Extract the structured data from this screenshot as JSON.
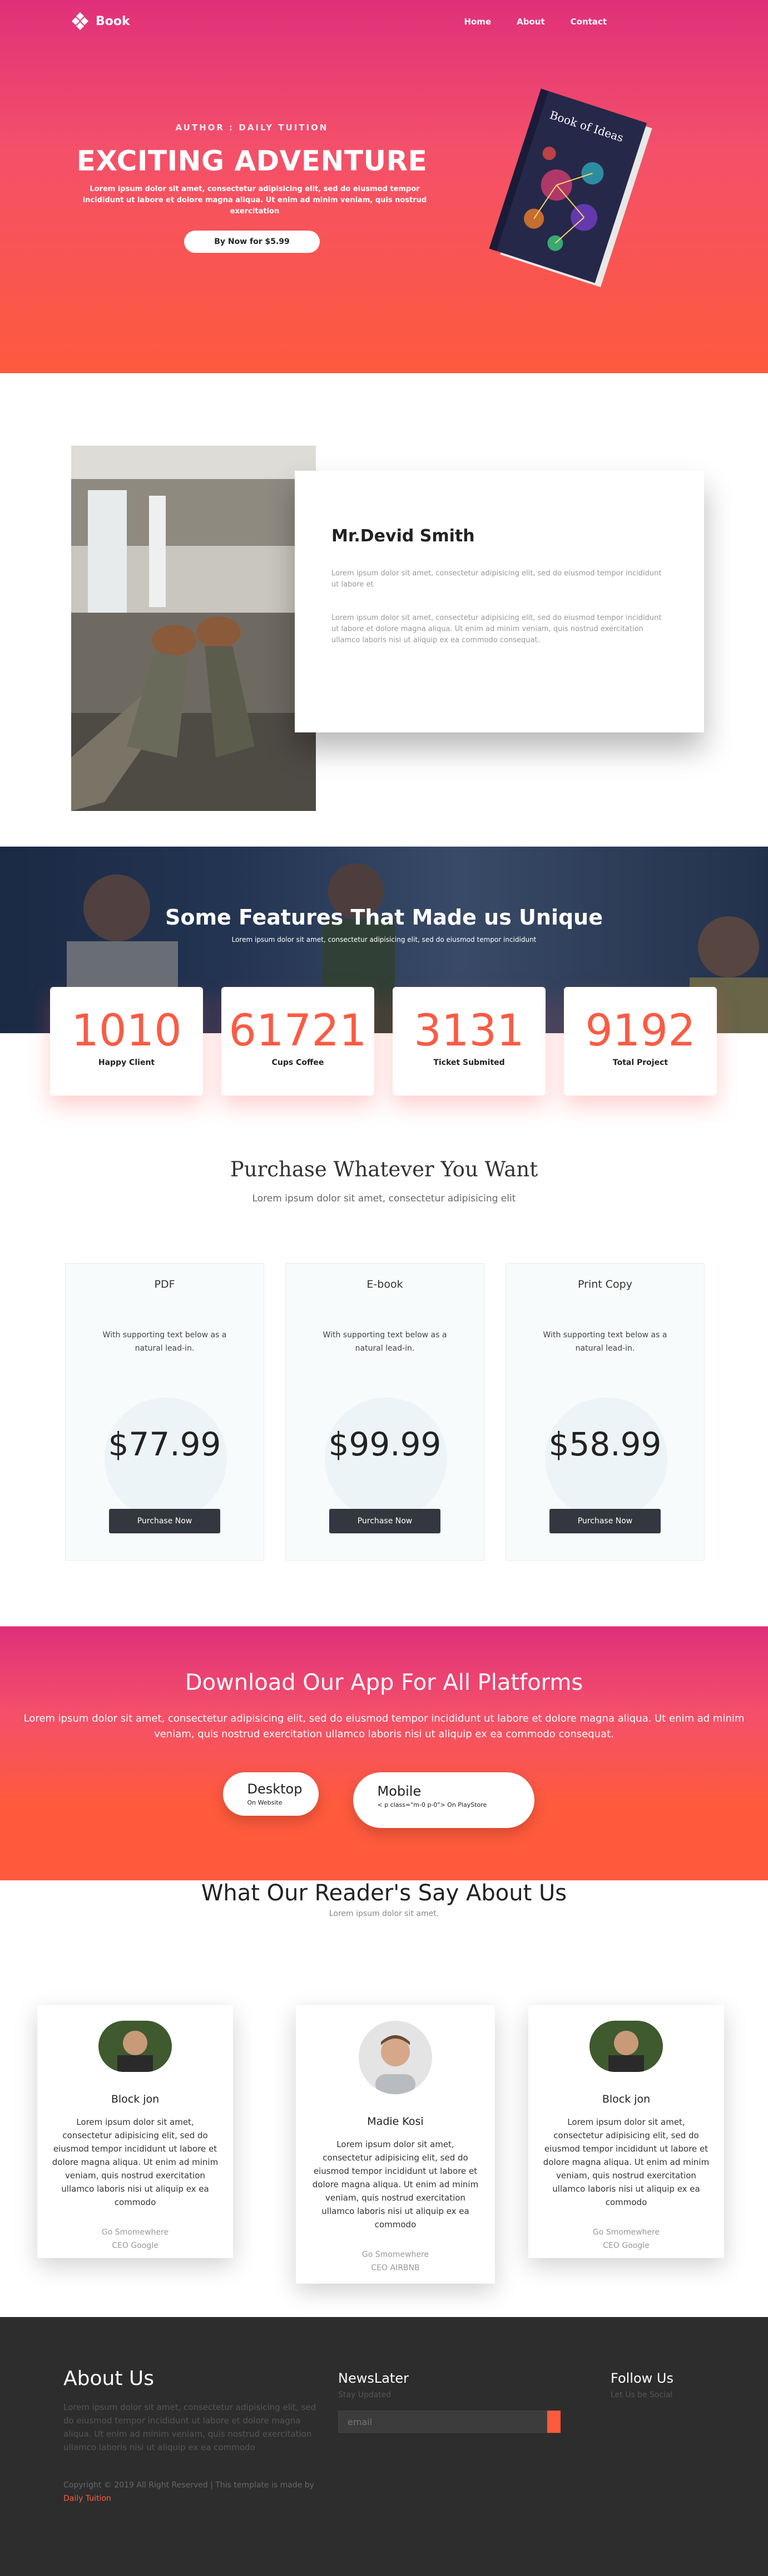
{
  "nav": {
    "brand": "Book",
    "links": [
      "Home",
      "About",
      "Contact"
    ]
  },
  "hero": {
    "subtitle": "AUTHOR : DAILY TUITION",
    "title": "EXCITING ADVENTURE",
    "description": "Lorem ipsum dolor sit amet, consectetur adipisicing elit, sed do eiusmod tempor incididunt ut labore et dolore magna aliqua. Ut enim ad minim veniam, quis nostrud exercitation",
    "button": "By Now for $5.99"
  },
  "book": {
    "cover_title": "Book of Ideas"
  },
  "profile": {
    "name": "Mr.Devid Smith",
    "p1": "Lorem ipsum dolor sit amet, consectetur adipisicing elit, sed do eiusmod tempor incididunt ut labore et",
    "p2": "Lorem ipsum dolor sit amet, consectetur adipisicing elit, sed do eiusmod tempor incididunt ut labore et dolore magna aliqua. Ut enim ad minim veniam, quis nostrud exercitation ullamco laboris nisi ut aliquip ex ea commodo consequat."
  },
  "features": {
    "title": "Some Features That Made us Unique",
    "subtitle": "Lorem ipsum dolor sit amet, consectetur adipisicing elit, sed do eiusmod tempor incididunt",
    "stats": [
      {
        "value": "1010",
        "label": "Happy Client"
      },
      {
        "value": "61721",
        "label": "Cups Coffee"
      },
      {
        "value": "3131",
        "label": "Ticket Submited"
      },
      {
        "value": "9192",
        "label": "Total Project"
      }
    ]
  },
  "purchase": {
    "title": "Purchase Whatever You Want",
    "subtitle": "Lorem ipsum dolor sit amet, consectetur adipisicing elit",
    "plans": [
      {
        "name": "PDF",
        "text": "With supporting text below as a natural lead-in.",
        "price": "$77.99",
        "button": "Purchase Now"
      },
      {
        "name": "E-book",
        "text": "With supporting text below as a natural lead-in.",
        "price": "$99.99",
        "button": "Purchase Now"
      },
      {
        "name": "Print Copy",
        "text": "With supporting text below as a natural lead-in.",
        "price": "$58.99",
        "button": "Purchase Now"
      }
    ]
  },
  "app": {
    "title": "Download Our App For All Platforms",
    "description": "Lorem ipsum dolor sit amet, consectetur adipisicing elit, sed do eiusmod tempor incididunt ut labore et dolore magna aliqua. Ut enim ad minim veniam, quis nostrud exercitation ullamco laboris nisi ut aliquip ex ea commodo consequat.",
    "desktop": {
      "title": "Desktop",
      "sub": "On Website"
    },
    "mobile": {
      "title": "Mobile",
      "sub": "< p class=\"m-0 p-0\"> On PlayStore"
    }
  },
  "testimonials": {
    "title": "What Our Reader's Say About Us",
    "subtitle": "Lorem ipsum dolor sit amet.",
    "items": [
      {
        "name": "Block jon",
        "body": "Lorem ipsum dolor sit amet, consectetur adipisicing elit, sed do eiusmod tempor incididunt ut labore et dolore magna aliqua. Ut enim ad minim veniam, quis nostrud exercitation ullamco laboris nisi ut aliquip ex ea commodo",
        "place": "Go Smomewhere",
        "role": "CEO Google"
      },
      {
        "name": "Madie Kosi",
        "body": "Lorem ipsum dolor sit amet, consectetur adipisicing elit, sed do eiusmod tempor incididunt ut labore et dolore magna aliqua. Ut enim ad minim veniam, quis nostrud exercitation ullamco laboris nisi ut aliquip ex ea commodo",
        "place": "Go Smomewhere",
        "role": "CEO AIRBNB"
      },
      {
        "name": "Block jon",
        "body": "Lorem ipsum dolor sit amet, consectetur adipisicing elit, sed do eiusmod tempor incididunt ut labore et dolore magna aliqua. Ut enim ad minim veniam, quis nostrud exercitation ullamco laboris nisi ut aliquip ex ea commodo",
        "place": "Go Smomewhere",
        "role": "CEO Google"
      }
    ]
  },
  "footer": {
    "about_title": "About Us",
    "about_text": "Lorem ipsum dolor sit amet, consectetur adipisicing elit, sed do eiusmod tempor incididunt ut labore et dolore magna aliqua. Ut enim ad minim veniam, quis nostrud exercitation ullamco laboris nisi ut aliquip ex ea commodo",
    "copyright": "Copyright © 2019 All Right Reserved | This template is made by",
    "copyright_link": "Daily Tuition",
    "news_title": "NewsLater",
    "news_sub": "Stay Updated",
    "email_placeholder": "email",
    "follow_title": "Follow Us",
    "follow_sub": "Let Us be Social"
  },
  "colors": {
    "accent": "#ff5a3c",
    "gradient_top": "#e0307a",
    "dark": "#2d2d2d"
  }
}
